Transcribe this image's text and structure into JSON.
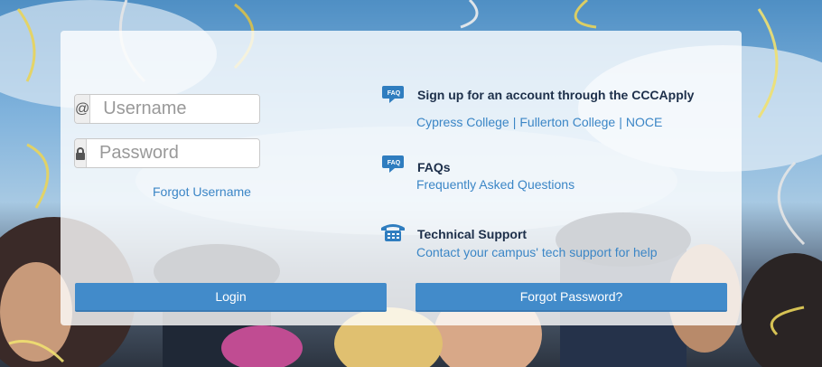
{
  "login": {
    "username_icon": "at-sign-icon",
    "username_placeholder": "Username",
    "password_icon": "lock-icon",
    "password_placeholder": "Password",
    "forgot_username": "Forgot Username",
    "login_button": "Login"
  },
  "info": {
    "signup": {
      "icon": "faq-icon",
      "title": "Sign up for an account through the CCCApply",
      "links": [
        "Cypress College",
        "Fullerton College",
        "NOCE"
      ],
      "separator": "|"
    },
    "faqs": {
      "icon": "faq-icon",
      "title": "FAQs",
      "link": "Frequently Asked Questions"
    },
    "support": {
      "icon": "telephone-icon",
      "title": "Technical Support",
      "link": "Contact your campus' tech support for help"
    },
    "forgot_password_button": "Forgot Password?"
  },
  "colors": {
    "link": "#3b86c6",
    "button": "#428bca",
    "title": "#1d2f4a"
  }
}
